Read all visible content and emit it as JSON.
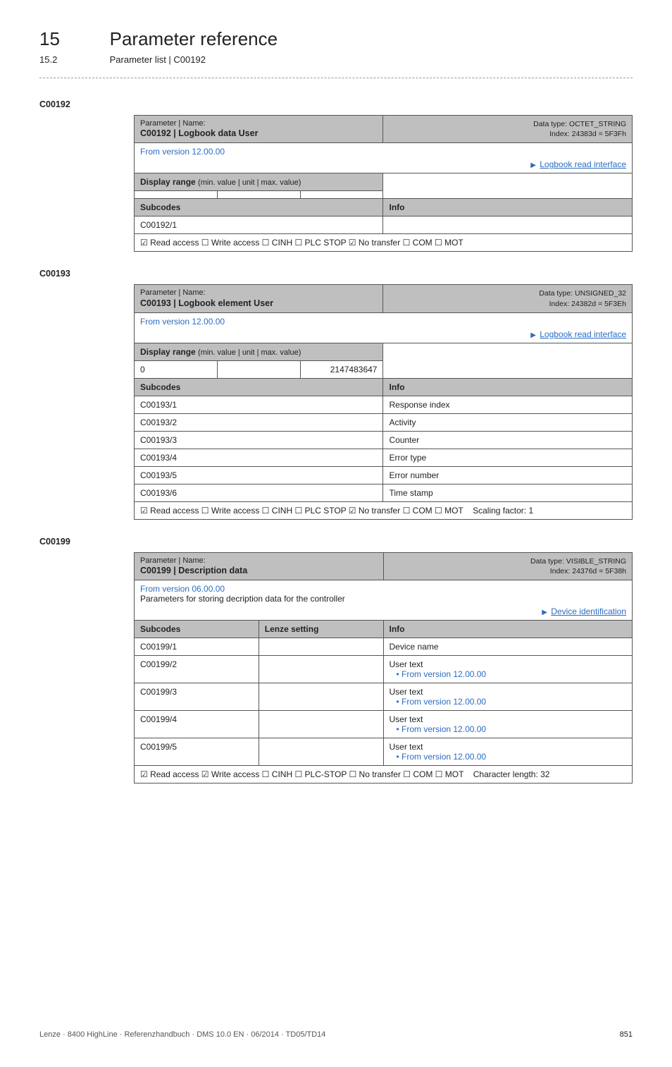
{
  "header": {
    "chapter_num": "15",
    "chapter_title": "Parameter reference",
    "section_num": "15.2",
    "section_title": "Parameter list | C00192"
  },
  "c00192": {
    "label": "C00192",
    "pn_label": "Parameter | Name:",
    "pn_name": "C00192 | Logbook data User",
    "data_type": "Data type: OCTET_STRING",
    "index": "Index: 24383d = 5F3Fh",
    "version": "From version 12.00.00",
    "interface_link": "Logbook read interface",
    "display_range_label": "Display range",
    "display_range_sub": "(min. value | unit | max. value)",
    "subcodes_label": "Subcodes",
    "info_label": "Info",
    "row1_sub": "C00192/1",
    "access": "☑ Read access   ☐ Write access   ☐ CINH   ☐ PLC STOP   ☑ No transfer   ☐ COM   ☐ MOT"
  },
  "c00193": {
    "label": "C00193",
    "pn_label": "Parameter | Name:",
    "pn_name": "C00193 | Logbook element User",
    "data_type": "Data type: UNSIGNED_32",
    "index": "Index: 24382d = 5F3Eh",
    "version": "From version 12.00.00",
    "interface_link": "Logbook read interface",
    "display_range_label": "Display range",
    "display_range_sub": "(min. value | unit | max. value)",
    "range_min": "0",
    "range_max": "2147483647",
    "subcodes_label": "Subcodes",
    "info_label": "Info",
    "rows": [
      {
        "sub": "C00193/1",
        "info": "Response index"
      },
      {
        "sub": "C00193/2",
        "info": "Activity"
      },
      {
        "sub": "C00193/3",
        "info": "Counter"
      },
      {
        "sub": "C00193/4",
        "info": "Error type"
      },
      {
        "sub": "C00193/5",
        "info": "Error number"
      },
      {
        "sub": "C00193/6",
        "info": "Time stamp"
      }
    ],
    "access": "☑ Read access   ☐ Write access   ☐ CINH   ☐ PLC STOP   ☑ No transfer   ☐ COM   ☐ MOT",
    "scaling": "Scaling factor: 1"
  },
  "c00199": {
    "label": "C00199",
    "pn_label": "Parameter | Name:",
    "pn_name": "C00199 | Description data",
    "data_type": "Data type: VISIBLE_STRING",
    "index": "Index: 24376d = 5F38h",
    "version": "From version 06.00.00",
    "desc": "Parameters for storing decription data for the controller",
    "interface_link": "Device identification",
    "subcodes_label": "Subcodes",
    "lenze_label": "Lenze setting",
    "info_label": "Info",
    "rows": [
      {
        "sub": "C00199/1",
        "info": "Device name",
        "link": ""
      },
      {
        "sub": "C00199/2",
        "info": "User text",
        "link": "• From version 12.00.00"
      },
      {
        "sub": "C00199/3",
        "info": "User text",
        "link": "• From version 12.00.00"
      },
      {
        "sub": "C00199/4",
        "info": "User text",
        "link": "• From version 12.00.00"
      },
      {
        "sub": "C00199/5",
        "info": "User text",
        "link": "• From version 12.00.00"
      }
    ],
    "access": "☑ Read access   ☑ Write access   ☐ CINH   ☐ PLC-STOP   ☐ No transfer   ☐ COM   ☐ MOT",
    "char_len": "Character length: 32"
  },
  "footer": {
    "left": "Lenze · 8400 HighLine · Referenzhandbuch · DMS 10.0 EN · 06/2014 · TD05/TD14",
    "page": "851"
  }
}
